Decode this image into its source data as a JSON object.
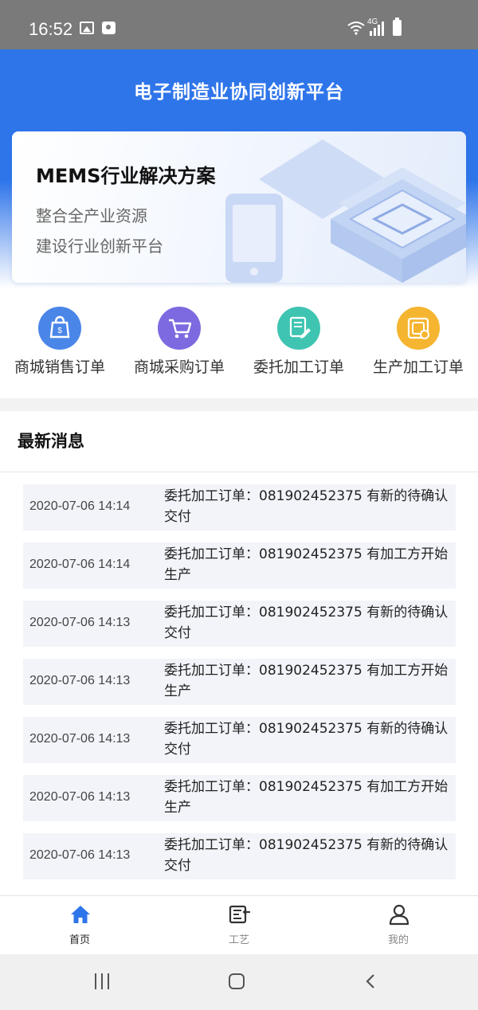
{
  "status_bar": {
    "time": "16:52",
    "network_label": "4G",
    "icons": [
      "gallery-icon",
      "camera-icon",
      "wifi-icon",
      "signal-icon",
      "battery-icon"
    ]
  },
  "header": {
    "title": "电子制造业协同创新平台"
  },
  "banner": {
    "title": "MEMS行业解决方案",
    "line1": "整合全产业资源",
    "line2": "建设行业创新平台"
  },
  "quick_menu": [
    {
      "label": "商城销售订单",
      "icon": "shopping-bag-icon",
      "color": "#4a86e8"
    },
    {
      "label": "商城采购订单",
      "icon": "shopping-cart-icon",
      "color": "#7d6ae0"
    },
    {
      "label": "委托加工订单",
      "icon": "document-edit-icon",
      "color": "#3fc4b2"
    },
    {
      "label": "生产加工订单",
      "icon": "production-icon",
      "color": "#f5b530"
    }
  ],
  "news": {
    "heading": "最新消息",
    "items": [
      {
        "time": "2020-07-06 14:14",
        "text": "委托加工订单：081902452375 有新的待确认交付"
      },
      {
        "time": "2020-07-06 14:14",
        "text": "委托加工订单：081902452375 有加工方开始生产"
      },
      {
        "time": "2020-07-06 14:13",
        "text": "委托加工订单：081902452375 有新的待确认交付"
      },
      {
        "time": "2020-07-06 14:13",
        "text": "委托加工订单：081902452375 有加工方开始生产"
      },
      {
        "time": "2020-07-06 14:13",
        "text": "委托加工订单：081902452375 有新的待确认交付"
      },
      {
        "time": "2020-07-06 14:13",
        "text": "委托加工订单：081902452375 有加工方开始生产"
      },
      {
        "time": "2020-07-06 14:13",
        "text": "委托加工订单：081902452375 有新的待确认交付"
      }
    ]
  },
  "tabbar": {
    "items": [
      {
        "label": "首页",
        "icon": "home-icon",
        "active": true
      },
      {
        "label": "工艺",
        "icon": "process-icon",
        "active": false
      },
      {
        "label": "我的",
        "icon": "profile-icon",
        "active": false
      }
    ]
  },
  "colors": {
    "primary": "#2f75ea",
    "news_item_bg": "#f2f4f9",
    "status_bar": "#7a7a7a"
  }
}
